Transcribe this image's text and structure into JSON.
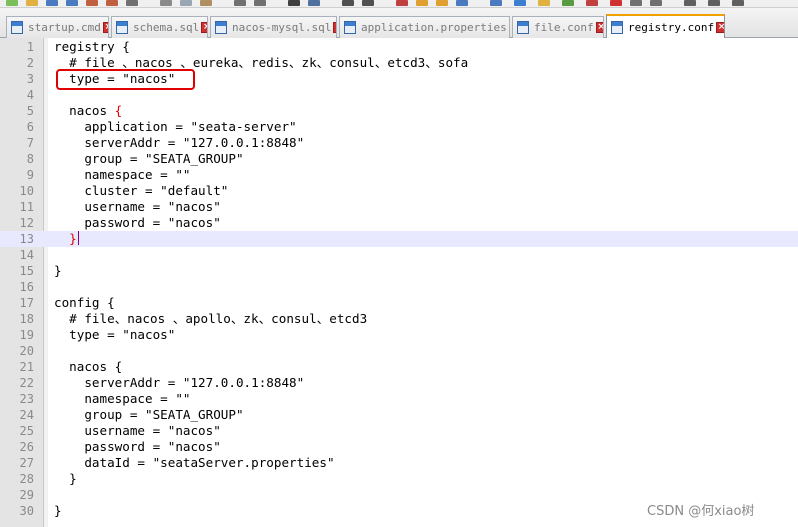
{
  "tabs": [
    {
      "label": "startup.cmd",
      "active": false
    },
    {
      "label": "schema.sql",
      "active": false
    },
    {
      "label": "nacos-mysql.sql",
      "active": false
    },
    {
      "label": "application.properties",
      "active": false
    },
    {
      "label": "file.conf",
      "active": false
    },
    {
      "label": "registry.conf",
      "active": true
    }
  ],
  "close_glyph": "×",
  "editor": {
    "current_line": 13,
    "lines": [
      {
        "n": "1",
        "text": "registry {"
      },
      {
        "n": "2",
        "text": "  # file 、nacos 、eureka、redis、zk、consul、etcd3、sofa"
      },
      {
        "n": "3",
        "text": "  type = \"nacos\""
      },
      {
        "n": "4",
        "text": ""
      },
      {
        "n": "5",
        "text": "  nacos ",
        "tail": "{"
      },
      {
        "n": "6",
        "text": "    application = \"seata-server\""
      },
      {
        "n": "7",
        "text": "    serverAddr = \"127.0.0.1:8848\""
      },
      {
        "n": "8",
        "text": "    group = \"SEATA_GROUP\""
      },
      {
        "n": "9",
        "text": "    namespace = \"\""
      },
      {
        "n": "10",
        "text": "    cluster = \"default\""
      },
      {
        "n": "11",
        "text": "    username = \"nacos\""
      },
      {
        "n": "12",
        "text": "    password = \"nacos\""
      },
      {
        "n": "13",
        "text": "  ",
        "tail": "}"
      },
      {
        "n": "14",
        "text": ""
      },
      {
        "n": "15",
        "text": "}"
      },
      {
        "n": "16",
        "text": ""
      },
      {
        "n": "17",
        "text": "config {"
      },
      {
        "n": "18",
        "text": "  # file、nacos 、apollo、zk、consul、etcd3"
      },
      {
        "n": "19",
        "text": "  type = \"nacos\""
      },
      {
        "n": "20",
        "text": ""
      },
      {
        "n": "21",
        "text": "  nacos {"
      },
      {
        "n": "22",
        "text": "    serverAddr = \"127.0.0.1:8848\""
      },
      {
        "n": "23",
        "text": "    namespace = \"\""
      },
      {
        "n": "24",
        "text": "    group = \"SEATA_GROUP\""
      },
      {
        "n": "25",
        "text": "    username = \"nacos\""
      },
      {
        "n": "26",
        "text": "    password = \"nacos\""
      },
      {
        "n": "27",
        "text": "    dataId = \"seataServer.properties\""
      },
      {
        "n": "28",
        "text": "  }"
      },
      {
        "n": "29",
        "text": ""
      },
      {
        "n": "30",
        "text": "}"
      }
    ]
  },
  "annotation": {
    "color": "#e00000",
    "target_line": 3
  },
  "watermark": "CSDN @何xiao树",
  "colors": {
    "brace_match": "#e00000",
    "current_line_bg": "#e8e8ff",
    "active_tab_accent": "#f0a000",
    "close_button": "#d03030"
  }
}
